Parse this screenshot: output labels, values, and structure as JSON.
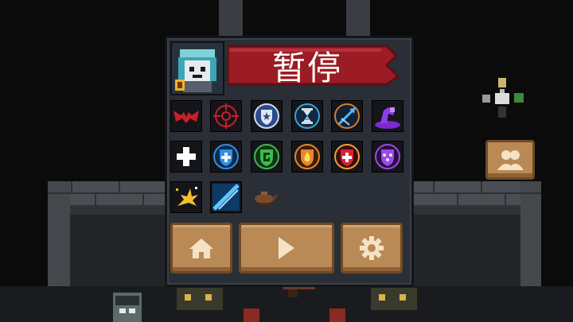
{
  "pause_menu": {
    "title": "暂停"
  },
  "buffs": {
    "row1": [
      "bat-wings-icon",
      "crosshair-icon",
      "shield-star-icon",
      "hourglass-icon",
      "arrow-slash-icon",
      "purple-hand-icon"
    ],
    "row2": [
      "plus-icon",
      "blue-shield-icon",
      "green-shield-icon",
      "fire-shield-icon",
      "health-shield-icon",
      "purple-shield-icon"
    ],
    "row3": [
      "explosion-icon",
      "blue-blade-icon",
      "magic-lamp-icon"
    ]
  },
  "buttons": {
    "home": "home-icon",
    "resume": "play-icon",
    "settings": "gear-icon",
    "party": "party-icon"
  },
  "colors": {
    "banner": "#9b1c24",
    "button": "#b98a55",
    "panel": "#2a2e36"
  }
}
